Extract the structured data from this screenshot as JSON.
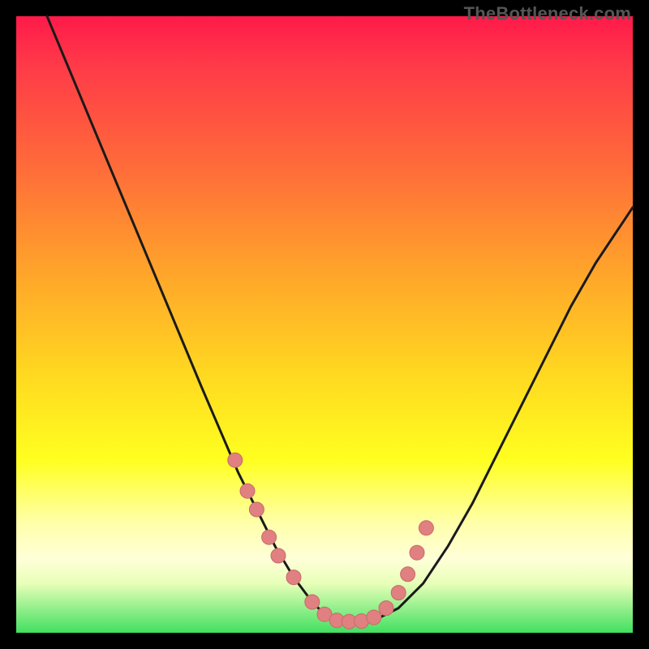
{
  "watermark": "TheBottleneck.com",
  "colors": {
    "background": "#000000",
    "gradient_top": "#ff1a4a",
    "gradient_mid1": "#ff6a3a",
    "gradient_mid2": "#ffd820",
    "gradient_bottom": "#40e060",
    "curve_stroke": "#1a1a1a",
    "marker_fill": "#e08080",
    "marker_stroke": "#c86a6a"
  },
  "chart_data": {
    "type": "line",
    "title": "",
    "xlabel": "",
    "ylabel": "",
    "xlim": [
      0,
      100
    ],
    "ylim": [
      0,
      100
    ],
    "grid": false,
    "legend": false,
    "series": [
      {
        "name": "bottleneck-curve",
        "x": [
          5,
          10,
          15,
          20,
          25,
          30,
          33,
          36,
          39,
          42,
          45,
          48,
          50,
          52,
          55,
          58,
          62,
          66,
          70,
          74,
          78,
          82,
          86,
          90,
          94,
          98,
          100
        ],
        "y": [
          100,
          88,
          76,
          64,
          52,
          40,
          33,
          26,
          20,
          14,
          9,
          5,
          3,
          2,
          1.5,
          2,
          4,
          8,
          14,
          21,
          29,
          37,
          45,
          53,
          60,
          66,
          69
        ]
      }
    ],
    "markers": {
      "name": "highlighted-points",
      "x": [
        35.5,
        37.5,
        39,
        41,
        42.5,
        45,
        48,
        50,
        52,
        54,
        56,
        58,
        60,
        62,
        63.5,
        65,
        66.5
      ],
      "y": [
        28,
        23,
        20,
        15.5,
        12.5,
        9,
        5,
        3,
        2,
        1.8,
        1.9,
        2.5,
        4,
        6.5,
        9.5,
        13,
        17
      ]
    }
  }
}
